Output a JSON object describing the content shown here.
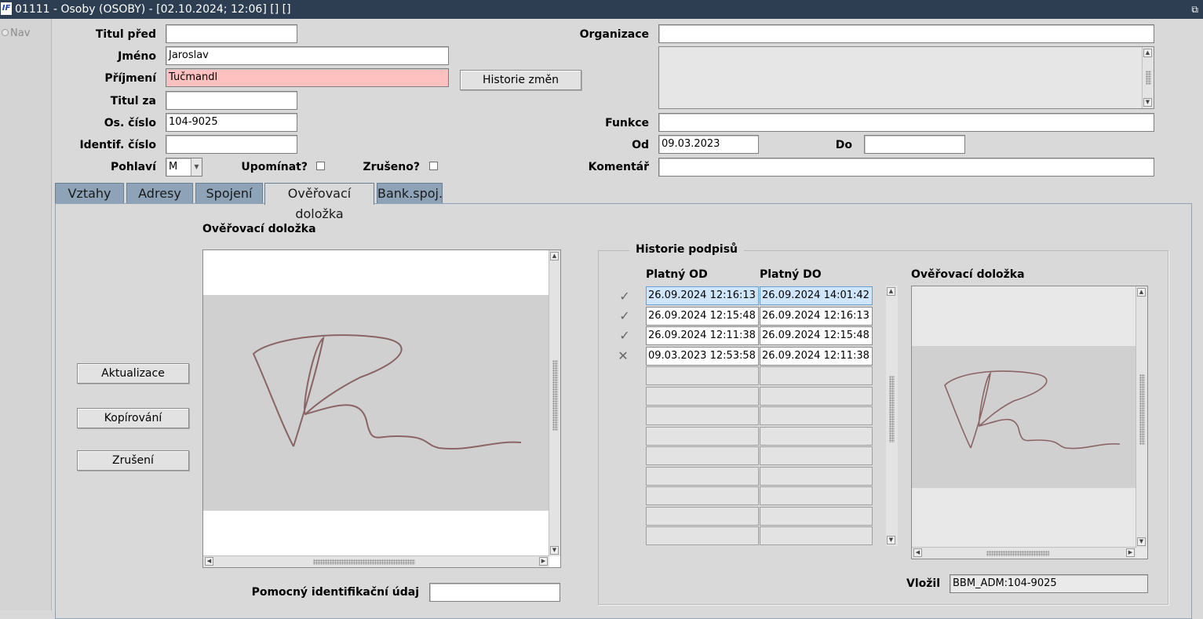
{
  "window": {
    "title": "01111 - Osoby (OSOBY) - [02.10.2024; 12:06]  []  []",
    "logo_text": "IF",
    "restore_glyph": "⧉"
  },
  "nav": {
    "label": "Nav"
  },
  "form": {
    "titul_pred": {
      "label": "Titul před",
      "value": ""
    },
    "jmeno": {
      "label": "Jméno",
      "value": "Jaroslav"
    },
    "prijmeni": {
      "label": "Příjmení",
      "value": "Tučmandl"
    },
    "titul_za": {
      "label": "Titul za",
      "value": ""
    },
    "os_cislo": {
      "label": "Os. číslo",
      "value": "104-9025"
    },
    "identif_cislo": {
      "label": "Identif. číslo",
      "value": ""
    },
    "pohlavi": {
      "label": "Pohlaví",
      "value": "M"
    },
    "upominat": {
      "label": "Upomínat?",
      "checked": false
    },
    "zruseno": {
      "label": "Zrušeno?",
      "checked": false
    },
    "historie_button": "Historie změn",
    "organizace": {
      "label": "Organizace",
      "value": ""
    },
    "funkce": {
      "label": "Funkce",
      "value": ""
    },
    "od": {
      "label": "Od",
      "value": "09.03.2023"
    },
    "do": {
      "label": "Do",
      "value": ""
    },
    "komentar": {
      "label": "Komentář",
      "value": ""
    }
  },
  "tabs": [
    {
      "label": "Vztahy"
    },
    {
      "label": "Adresy"
    },
    {
      "label": "Spojení"
    },
    {
      "label": "Ověřovací doložka"
    },
    {
      "label": "Bank.spoj."
    }
  ],
  "active_tab": "Ověřovací doložka",
  "panel": {
    "signature_title": "Ověřovací doložka",
    "buttons": {
      "aktualizace": "Aktualizace",
      "kopirovani": "Kopírování",
      "zruseni": "Zrušení"
    },
    "pomocny": {
      "label": "Pomocný identifikační údaj",
      "value": ""
    },
    "history": {
      "group_title": "Historie podpisů",
      "col_od": "Platný OD",
      "col_do": "Platný DO",
      "rows": [
        {
          "mark": "✓",
          "od": "26.09.2024 12:16:13",
          "do": "26.09.2024 14:01:42"
        },
        {
          "mark": "✓",
          "od": "26.09.2024 12:15:48",
          "do": "26.09.2024 12:16:13"
        },
        {
          "mark": "✓",
          "od": "26.09.2024 12:11:38",
          "do": "26.09.2024 12:15:48"
        },
        {
          "mark": "✕",
          "od": "09.03.2023 12:53:58",
          "do": "26.09.2024 12:11:38"
        }
      ],
      "preview_title": "Ověřovací doložka",
      "vlozil": {
        "label": "Vložil",
        "value": "BBM_ADM:104-9025"
      }
    }
  },
  "colors": {
    "titlebar": "#2d3e52",
    "tab_inactive": "#8ea3b7",
    "required_field": "#ffc0c0",
    "selected_row": "#cfe6fa",
    "signature_ink": "#8a6464"
  }
}
